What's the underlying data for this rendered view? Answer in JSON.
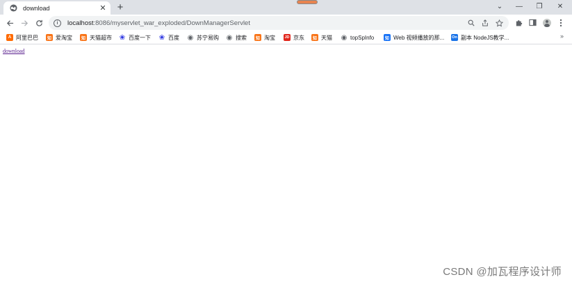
{
  "browser": {
    "tab": {
      "title": "download",
      "favicon": "globe-icon"
    },
    "new_tab_label": "+",
    "window_controls": {
      "dropdown": "⌄",
      "minimize": "—",
      "restore": "❐",
      "close": "✕"
    },
    "address": {
      "host": "localhost",
      "path": ":8086/myservlet_war_exploded/DownManagerServlet"
    },
    "bookmarks": [
      {
        "label": "阿里巴巴",
        "icon": "alibaba-icon",
        "color": "#ff6a00",
        "glyph": "A"
      },
      {
        "label": "爱淘宝",
        "icon": "zhi-icon",
        "color": "#f97316",
        "glyph": "知"
      },
      {
        "label": "天猫超市",
        "icon": "zhi-icon",
        "color": "#f97316",
        "glyph": "知"
      },
      {
        "label": "百度一下",
        "icon": "baidu-paw-icon",
        "color": "#2932e1",
        "glyph": "❀"
      },
      {
        "label": "百度",
        "icon": "baidu-paw-icon",
        "color": "#2932e1",
        "glyph": "❀"
      },
      {
        "label": "苏宁易购",
        "icon": "globe-icon",
        "color": "#5f6368",
        "glyph": "◉"
      },
      {
        "label": "搜索",
        "icon": "globe-icon",
        "color": "#5f6368",
        "glyph": "◉"
      },
      {
        "label": "淘宝",
        "icon": "zhi-icon",
        "color": "#f97316",
        "glyph": "知"
      },
      {
        "label": "京东",
        "icon": "jd-icon",
        "color": "#e1251b",
        "glyph": "JD"
      },
      {
        "label": "天猫",
        "icon": "zhi-icon",
        "color": "#f97316",
        "glyph": "知"
      },
      {
        "label": "topSpInfo",
        "icon": "globe-icon",
        "color": "#5f6368",
        "glyph": "◉"
      },
      {
        "label": "Web 视频播放的那...",
        "icon": "zhihu-icon",
        "color": "#1772f6",
        "glyph": "知"
      },
      {
        "label": "副本 NodeJS教学...",
        "icon": "on-icon",
        "color": "#1a73e8",
        "glyph": "On"
      }
    ],
    "bookmarks_more": "»"
  },
  "page": {
    "link_text": "download"
  },
  "watermark": "CSDN @加瓦程序设计师"
}
